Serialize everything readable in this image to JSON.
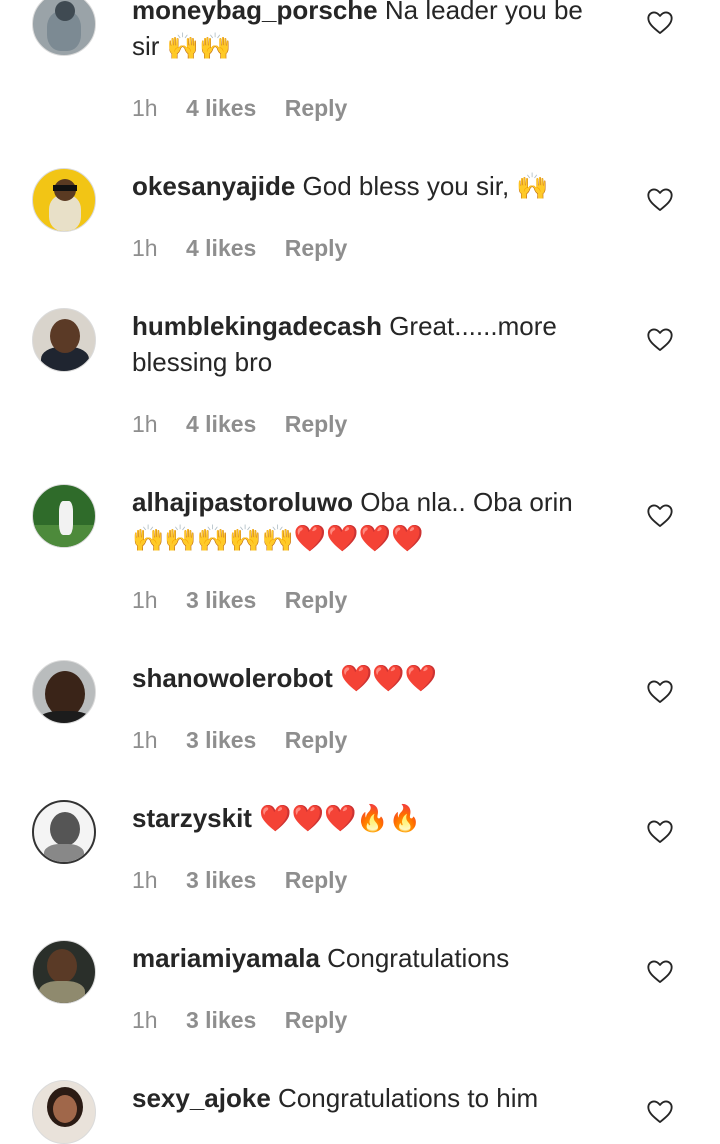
{
  "comments": [
    {
      "username": "moneybag_porsche",
      "text": "Na leader you be sir 🙌🙌",
      "time": "1h",
      "likes": "4 likes",
      "reply": "Reply"
    },
    {
      "username": "okesanyajide",
      "text": "God bless you sir, 🙌",
      "time": "1h",
      "likes": "4 likes",
      "reply": "Reply"
    },
    {
      "username": "humblekingadecash",
      "text": "Great......more blessing bro",
      "time": "1h",
      "likes": "4 likes",
      "reply": "Reply"
    },
    {
      "username": "alhajipastoroluwo",
      "text": "Oba nla.. Oba orin 🙌🙌🙌🙌🙌❤️❤️❤️❤️",
      "time": "1h",
      "likes": "3 likes",
      "reply": "Reply"
    },
    {
      "username": "shanowolerobot",
      "text": "❤️❤️❤️",
      "time": "1h",
      "likes": "3 likes",
      "reply": "Reply"
    },
    {
      "username": "starzyskit",
      "text": "❤️❤️❤️🔥🔥",
      "time": "1h",
      "likes": "3 likes",
      "reply": "Reply"
    },
    {
      "username": "mariamiyamala",
      "text": "Congratulations",
      "time": "1h",
      "likes": "3 likes",
      "reply": "Reply"
    },
    {
      "username": "sexy_ajoke",
      "text": "Congratulations to him",
      "time": "",
      "likes": "",
      "reply": ""
    }
  ],
  "icons": {
    "like": "heart-outline-icon",
    "avatar": "user-avatar"
  },
  "colors": {
    "text": "#262626",
    "meta": "#8e8e8e",
    "heart_stroke": "#262626",
    "background": "#ffffff"
  }
}
